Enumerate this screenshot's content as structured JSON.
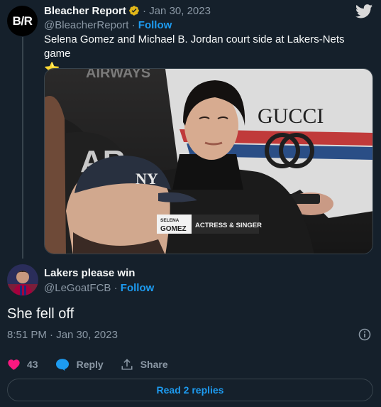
{
  "original_tweet": {
    "avatar_text": "B/R",
    "display_name": "Bleacher Report",
    "date": "Jan 30, 2023",
    "handle": "@BleacherReport",
    "follow_label": "Follow",
    "text": "Selena Gomez and Michael B. Jordan court side at Lakers-Nets game",
    "emoji": "⭐",
    "media": {
      "caption_name_top": "SELENA",
      "caption_name_bottom": "GOMEZ",
      "caption_title": "ACTRESS & SINGER",
      "cap_logo": "NY",
      "shirt_text": "GUCCI",
      "arena_text": "AIRWAYS"
    }
  },
  "reply": {
    "display_name": "Lakers please win",
    "handle": "@LeGoatFCB",
    "follow_label": "Follow",
    "text": "She fell off",
    "timestamp": "8:51 PM · Jan 30, 2023"
  },
  "actions": {
    "like_count": "43",
    "reply_label": "Reply",
    "share_label": "Share"
  },
  "read_replies_label": "Read 2 replies",
  "icons": [
    "twitter-bird-icon",
    "verified-badge-icon",
    "info-icon",
    "heart-icon",
    "reply-bubble-icon",
    "share-icon"
  ],
  "colors": {
    "background": "#15202b",
    "accent": "#1d9bf0",
    "like": "#f91880",
    "verified": "#e2b719",
    "muted": "#8b98a5"
  }
}
